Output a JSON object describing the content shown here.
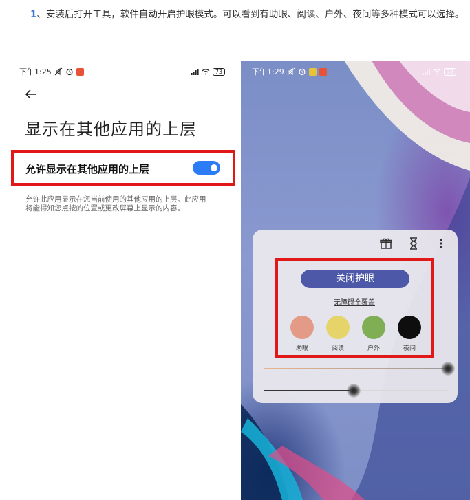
{
  "intro": {
    "number": "1",
    "text": "、安装后打开工具，软件自动开启护眼模式。可以看到有助眼、阅读、户外、夜间等多种模式可以选择。"
  },
  "left_phone": {
    "status": {
      "time": "下午1:25",
      "battery": "73"
    },
    "page_title": "显示在其他应用的上层",
    "toggle_label": "允许显示在其他应用的上层",
    "toggle_on": true,
    "description": "允许此应用显示在您当前使用的其他应用的上层。此应用将能得知您点按的位置或更改屏幕上显示的内容。"
  },
  "right_phone": {
    "status": {
      "time": "下午1:29",
      "battery": "72"
    },
    "panel": {
      "close_button": "关闭护眼",
      "no_obstacle_link": "无障碍全覆盖",
      "modes": [
        {
          "label": "助眠",
          "color": "#e39a86"
        },
        {
          "label": "阅读",
          "color": "#e6d46a"
        },
        {
          "label": "户外",
          "color": "#7fae55"
        },
        {
          "label": "夜间",
          "color": "#0e0e0e"
        }
      ],
      "slider_1_level": 1.0,
      "slider_2_level": 0.49
    }
  },
  "colors": {
    "highlight": "#e01818",
    "toggle": "#2b7cf6",
    "close_button": "#4d59a8",
    "intro_number": "#3a7bd5"
  }
}
